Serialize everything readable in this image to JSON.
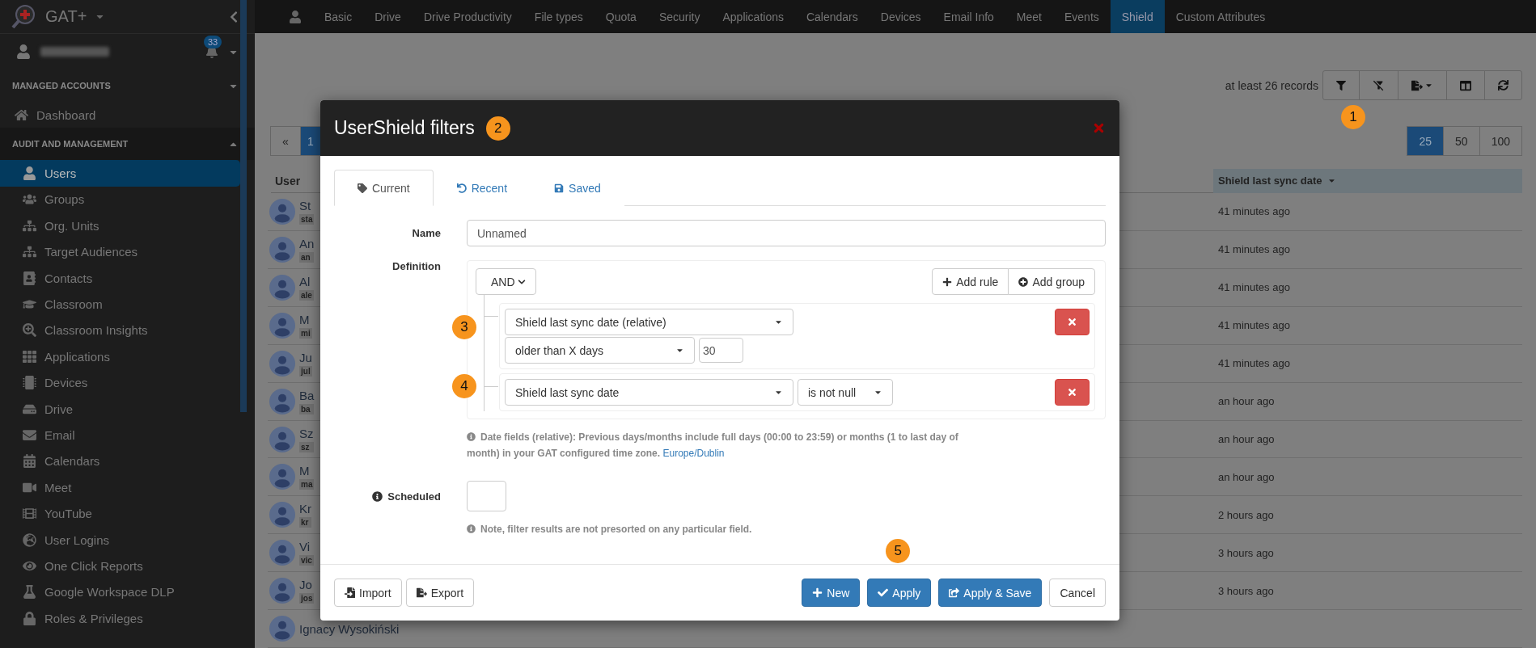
{
  "app": {
    "brand": "GAT+",
    "notification_count": "33"
  },
  "sidebar": {
    "sections": [
      {
        "title": "MANAGED ACCOUNTS",
        "expanded": false,
        "items": [
          {
            "label": "Dashboard",
            "selected": false
          }
        ]
      },
      {
        "title": "AUDIT AND MANAGEMENT",
        "expanded": true,
        "items": [
          {
            "label": "Users",
            "selected": true
          },
          {
            "label": "Groups",
            "selected": false
          },
          {
            "label": "Org. Units",
            "selected": false
          },
          {
            "label": "Target Audiences",
            "selected": false
          },
          {
            "label": "Contacts",
            "selected": false
          },
          {
            "label": "Classroom",
            "selected": false
          },
          {
            "label": "Classroom Insights",
            "selected": false
          },
          {
            "label": "Applications",
            "selected": false
          },
          {
            "label": "Devices",
            "selected": false
          },
          {
            "label": "Drive",
            "selected": false
          },
          {
            "label": "Email",
            "selected": false
          },
          {
            "label": "Calendars",
            "selected": false
          },
          {
            "label": "Meet",
            "selected": false
          },
          {
            "label": "YouTube",
            "selected": false
          },
          {
            "label": "User Logins",
            "selected": false
          },
          {
            "label": "One Click Reports",
            "selected": false
          },
          {
            "label": "Google Workspace DLP",
            "selected": false
          },
          {
            "label": "Roles & Privileges",
            "selected": false
          }
        ]
      }
    ]
  },
  "top_tabs": [
    {
      "label": "Basic",
      "selected": false
    },
    {
      "label": "Drive",
      "selected": false
    },
    {
      "label": "Drive Productivity",
      "selected": false
    },
    {
      "label": "File types",
      "selected": false
    },
    {
      "label": "Quota",
      "selected": false
    },
    {
      "label": "Security",
      "selected": false
    },
    {
      "label": "Applications",
      "selected": false
    },
    {
      "label": "Calendars",
      "selected": false
    },
    {
      "label": "Devices",
      "selected": false
    },
    {
      "label": "Email Info",
      "selected": false
    },
    {
      "label": "Meet",
      "selected": false
    },
    {
      "label": "Events",
      "selected": false
    },
    {
      "label": "Shield",
      "selected": true
    },
    {
      "label": "Custom Attributes",
      "selected": false
    }
  ],
  "toolbar": {
    "record_count": "at least 26 records",
    "callout": "1"
  },
  "pagination": [
    {
      "label": "«",
      "selected": false
    },
    {
      "label": "1",
      "selected": true
    }
  ],
  "page_sizes": [
    {
      "label": "25",
      "selected": true
    },
    {
      "label": "50",
      "selected": false
    },
    {
      "label": "100",
      "selected": false
    }
  ],
  "table": {
    "columns": [
      "User",
      "Shield last sync date"
    ],
    "rows": [
      {
        "name": "St",
        "email": "sta",
        "last_sync": "41 minutes ago"
      },
      {
        "name": "An",
        "email": "an",
        "last_sync": "41 minutes ago"
      },
      {
        "name": "Al",
        "email": "ale",
        "last_sync": "41 minutes ago"
      },
      {
        "name": "M",
        "email": "mi",
        "last_sync": "41 minutes ago"
      },
      {
        "name": "Ju",
        "email": "jul",
        "last_sync": "41 minutes ago"
      },
      {
        "name": "Ba",
        "email": "ba",
        "last_sync": "an hour ago"
      },
      {
        "name": "Sz",
        "email": "sz",
        "last_sync": "an hour ago"
      },
      {
        "name": "M",
        "email": "ma",
        "last_sync": "an hour ago"
      },
      {
        "name": "Kr",
        "email": "kr",
        "last_sync": "2 hours ago"
      },
      {
        "name": "Vi",
        "email": "vic",
        "last_sync": "3 hours ago"
      },
      {
        "name": "Jo",
        "email": "jos",
        "last_sync": "3 hours ago"
      },
      {
        "name": "Ignacy Wysokiński"
      }
    ]
  },
  "modal": {
    "title": "UserShield filters",
    "callout": "2",
    "tabs": [
      {
        "label": "Current",
        "selected": true
      },
      {
        "label": "Recent",
        "selected": false
      },
      {
        "label": "Saved",
        "selected": false
      }
    ],
    "name_label": "Name",
    "name_value": "Unnamed",
    "definition_label": "Definition",
    "conjunction": "AND",
    "add_rule": "Add rule",
    "add_group": "Add group",
    "rules": [
      {
        "kind": "stacked",
        "field": "Shield last sync date (relative)",
        "operator": "older than X days",
        "value": "30",
        "callout": "3"
      },
      {
        "kind": "inline",
        "field": "Shield last sync date",
        "operator": "is not null",
        "callout": "4"
      }
    ],
    "date_note": "Date fields (relative): Previous days/months include full days (00:00 to 23:59) or months (1 to last day of month) in your GAT configured time zone.",
    "time_zone_link": "Europe/Dublin",
    "scheduled_label": "Scheduled",
    "sort_note": "Note, filter results are not presorted on any particular field.",
    "footer_buttons": [
      {
        "label": "Import",
        "kind": "default"
      },
      {
        "label": "Export",
        "kind": "default"
      },
      {
        "label": "New",
        "kind": "primary"
      },
      {
        "label": "Apply",
        "kind": "primary",
        "callout": "5"
      },
      {
        "label": "Apply & Save",
        "kind": "primary"
      },
      {
        "label": "Cancel",
        "kind": "default"
      }
    ]
  }
}
